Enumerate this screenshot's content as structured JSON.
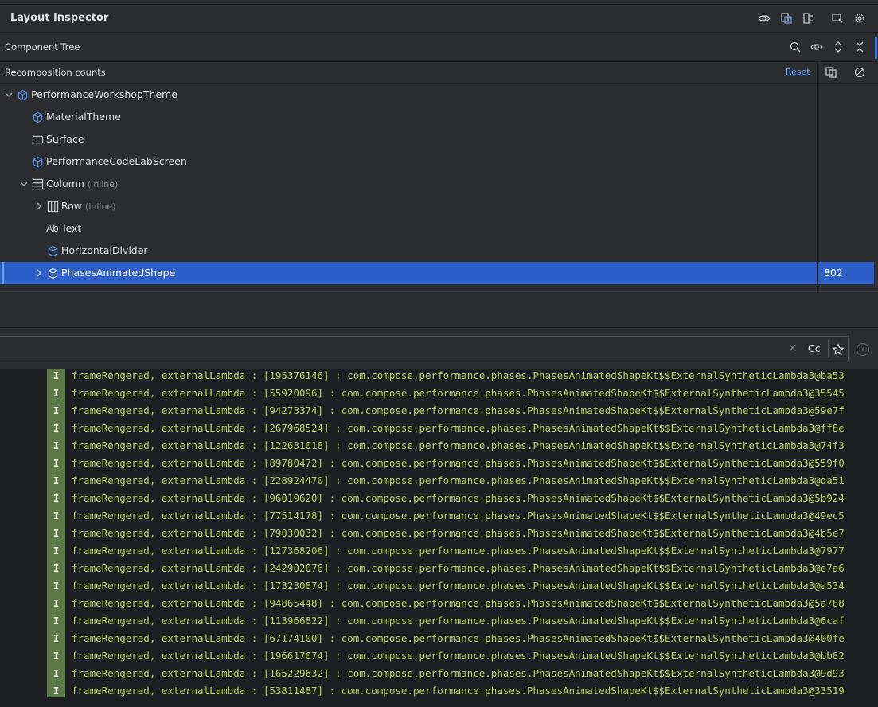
{
  "header": {
    "title": "Layout Inspector",
    "icons": [
      "eye-icon",
      "refresh-icon",
      "tree-icon",
      "inspect-icon",
      "gear-icon"
    ]
  },
  "component_tree": {
    "title": "Component Tree",
    "icons": [
      "search-icon",
      "eye-icon",
      "expand-icon",
      "collapse-icon"
    ]
  },
  "recomposition": {
    "title": "Recomposition counts",
    "reset_label": "Reset"
  },
  "tree": {
    "nodes": [
      {
        "label": "PerformanceWorkshopTheme",
        "inline": ""
      },
      {
        "label": "MaterialTheme",
        "inline": ""
      },
      {
        "label": "Surface",
        "inline": ""
      },
      {
        "label": "PerformanceCodeLabScreen",
        "inline": ""
      },
      {
        "label": "Column",
        "inline": "(inline)"
      },
      {
        "label": "Row",
        "inline": "(inline)"
      },
      {
        "label": "Text",
        "inline": "",
        "icon_text": "Ab"
      },
      {
        "label": "HorizontalDivider",
        "inline": ""
      },
      {
        "label": "PhasesAnimatedShape",
        "inline": "",
        "count": "802"
      }
    ]
  },
  "search": {
    "close_glyph": "✕",
    "match_case": "Cc",
    "help_glyph": "?"
  },
  "log": {
    "level": "I",
    "lines": [
      "frameRengered, externalLambda : [195376146] : com.compose.performance.phases.PhasesAnimatedShapeKt$$ExternalSyntheticLambda3@ba53",
      "frameRengered, externalLambda : [55920096] : com.compose.performance.phases.PhasesAnimatedShapeKt$$ExternalSyntheticLambda3@35545",
      "frameRengered, externalLambda : [94273374] : com.compose.performance.phases.PhasesAnimatedShapeKt$$ExternalSyntheticLambda3@59e7f",
      "frameRengered, externalLambda : [267968524] : com.compose.performance.phases.PhasesAnimatedShapeKt$$ExternalSyntheticLambda3@ff8e",
      "frameRengered, externalLambda : [122631018] : com.compose.performance.phases.PhasesAnimatedShapeKt$$ExternalSyntheticLambda3@74f3",
      "frameRengered, externalLambda : [89780472] : com.compose.performance.phases.PhasesAnimatedShapeKt$$ExternalSyntheticLambda3@559f0",
      "frameRengered, externalLambda : [228924470] : com.compose.performance.phases.PhasesAnimatedShapeKt$$ExternalSyntheticLambda3@da51",
      "frameRengered, externalLambda : [96019620] : com.compose.performance.phases.PhasesAnimatedShapeKt$$ExternalSyntheticLambda3@5b924",
      "frameRengered, externalLambda : [77514178] : com.compose.performance.phases.PhasesAnimatedShapeKt$$ExternalSyntheticLambda3@49ec5",
      "frameRengered, externalLambda : [79030032] : com.compose.performance.phases.PhasesAnimatedShapeKt$$ExternalSyntheticLambda3@4b5e7",
      "frameRengered, externalLambda : [127368206] : com.compose.performance.phases.PhasesAnimatedShapeKt$$ExternalSyntheticLambda3@7977",
      "frameRengered, externalLambda : [242902076] : com.compose.performance.phases.PhasesAnimatedShapeKt$$ExternalSyntheticLambda3@e7a6",
      "frameRengered, externalLambda : [173230874] : com.compose.performance.phases.PhasesAnimatedShapeKt$$ExternalSyntheticLambda3@a534",
      "frameRengered, externalLambda : [94865448] : com.compose.performance.phases.PhasesAnimatedShapeKt$$ExternalSyntheticLambda3@5a788",
      "frameRengered, externalLambda : [113966822] : com.compose.performance.phases.PhasesAnimatedShapeKt$$ExternalSyntheticLambda3@6caf",
      "frameRengered, externalLambda : [67174100] : com.compose.performance.phases.PhasesAnimatedShapeKt$$ExternalSyntheticLambda3@400fe",
      "frameRengered, externalLambda : [196617074] : com.compose.performance.phases.PhasesAnimatedShapeKt$$ExternalSyntheticLambda3@bb82",
      "frameRengered, externalLambda : [165229632] : com.compose.performance.phases.PhasesAnimatedShapeKt$$ExternalSyntheticLambda3@9d93",
      "frameRengered, externalLambda : [53811487] : com.compose.performance.phases.PhasesAnimatedShapeKt$$ExternalSyntheticLambda3@33519"
    ]
  }
}
